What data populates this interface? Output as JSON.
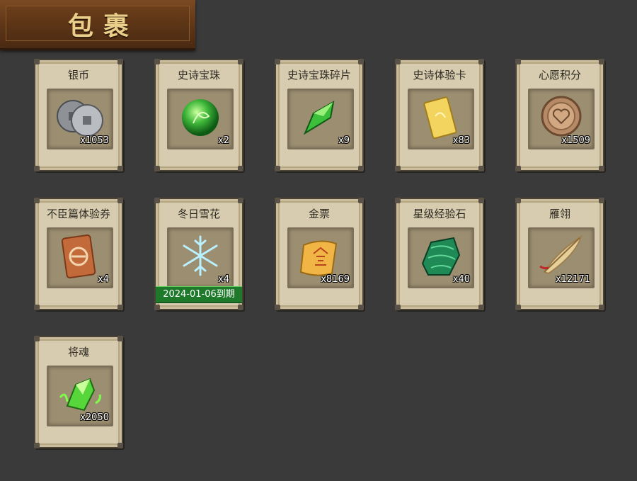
{
  "window": {
    "title": "包裹"
  },
  "items": [
    {
      "name": "银币",
      "count": "x1053",
      "icon": "coins-icon"
    },
    {
      "name": "史诗宝珠",
      "count": "x2",
      "icon": "green-orb-icon"
    },
    {
      "name": "史诗宝珠碎片",
      "count": "x9",
      "icon": "green-shard-icon"
    },
    {
      "name": "史诗体验卡",
      "count": "x83",
      "icon": "gold-card-icon"
    },
    {
      "name": "心愿积分",
      "count": "x1509",
      "icon": "heart-coin-icon"
    },
    {
      "name": "不臣篇体验券",
      "count": "x4",
      "icon": "ticket-icon"
    },
    {
      "name": "冬日雪花",
      "count": "x4",
      "icon": "snowflake-icon",
      "expiry": "2024-01-06到期"
    },
    {
      "name": "金票",
      "count": "x8169",
      "icon": "gold-scroll-icon"
    },
    {
      "name": "星级经验石",
      "count": "x40",
      "icon": "malachite-stone-icon"
    },
    {
      "name": "雁翎",
      "count": "x12171",
      "icon": "feather-icon"
    },
    {
      "name": "将魂",
      "count": "x2050",
      "icon": "green-crystal-icon"
    }
  ]
}
